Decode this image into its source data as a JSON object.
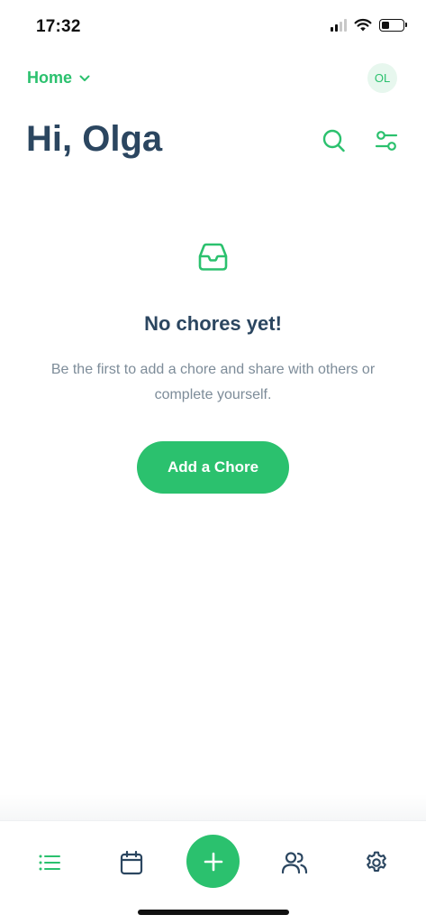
{
  "status_bar": {
    "time": "17:32",
    "icons": [
      "cellular-signal-icon",
      "wifi-icon",
      "battery-icon"
    ]
  },
  "header": {
    "home_label": "Home",
    "avatar_initials": "OL",
    "greeting": "Hi, Olga",
    "icons": [
      "search-icon",
      "filter-icon"
    ]
  },
  "empty_state": {
    "icon": "inbox-icon",
    "title": "No chores yet!",
    "description": "Be the first to add a chore and share with others or complete yourself.",
    "button_label": "Add a Chore"
  },
  "bottom_nav": {
    "items": [
      "list-icon",
      "calendar-icon",
      "plus-icon",
      "users-icon",
      "settings-icon"
    ],
    "active": "list-icon"
  },
  "colors": {
    "accent": "#2bc16e",
    "text_primary": "#2b4660",
    "text_secondary": "#7d8c99",
    "avatar_bg": "#e7f7ee"
  }
}
